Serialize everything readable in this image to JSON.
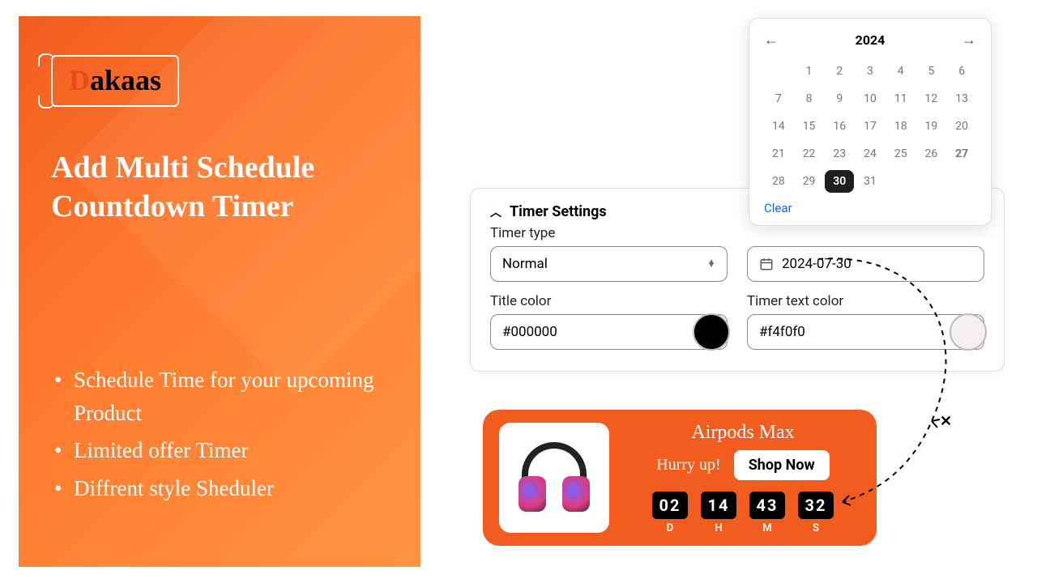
{
  "brand": {
    "accent_letter": "D",
    "rest": "akaas"
  },
  "left": {
    "title_line1": "Add Multi Schedule",
    "title_line2": "Countdown Timer",
    "bullets": [
      "Schedule Time for your upcoming Product",
      "Limited offer Timer",
      "Diffrent style Sheduler"
    ]
  },
  "settings": {
    "section_title": "Timer Settings",
    "timer_type_label": "Timer type",
    "timer_type_value": "Normal",
    "date_value": "2024-07-30",
    "title_color_label": "Title color",
    "title_color_value": "#000000",
    "timer_text_color_label": "Timer text color",
    "timer_text_color_value": "#f4f0f0"
  },
  "calendar": {
    "year": "2024",
    "days": [
      1,
      2,
      3,
      4,
      5,
      6,
      7,
      8,
      9,
      10,
      11,
      12,
      13,
      14,
      15,
      16,
      17,
      18,
      19,
      20,
      21,
      22,
      23,
      24,
      25,
      26,
      27,
      28,
      29,
      30,
      31
    ],
    "selected": 30,
    "bold": 27,
    "clear_label": "Clear"
  },
  "preview": {
    "product_name": "Airpods Max",
    "hurry": "Hurry up!",
    "cta": "Shop Now",
    "countdown": {
      "d": "02",
      "h": "14",
      "m": "43",
      "s": "32",
      "labels": {
        "d": "D",
        "h": "H",
        "m": "M",
        "s": "S"
      }
    }
  }
}
